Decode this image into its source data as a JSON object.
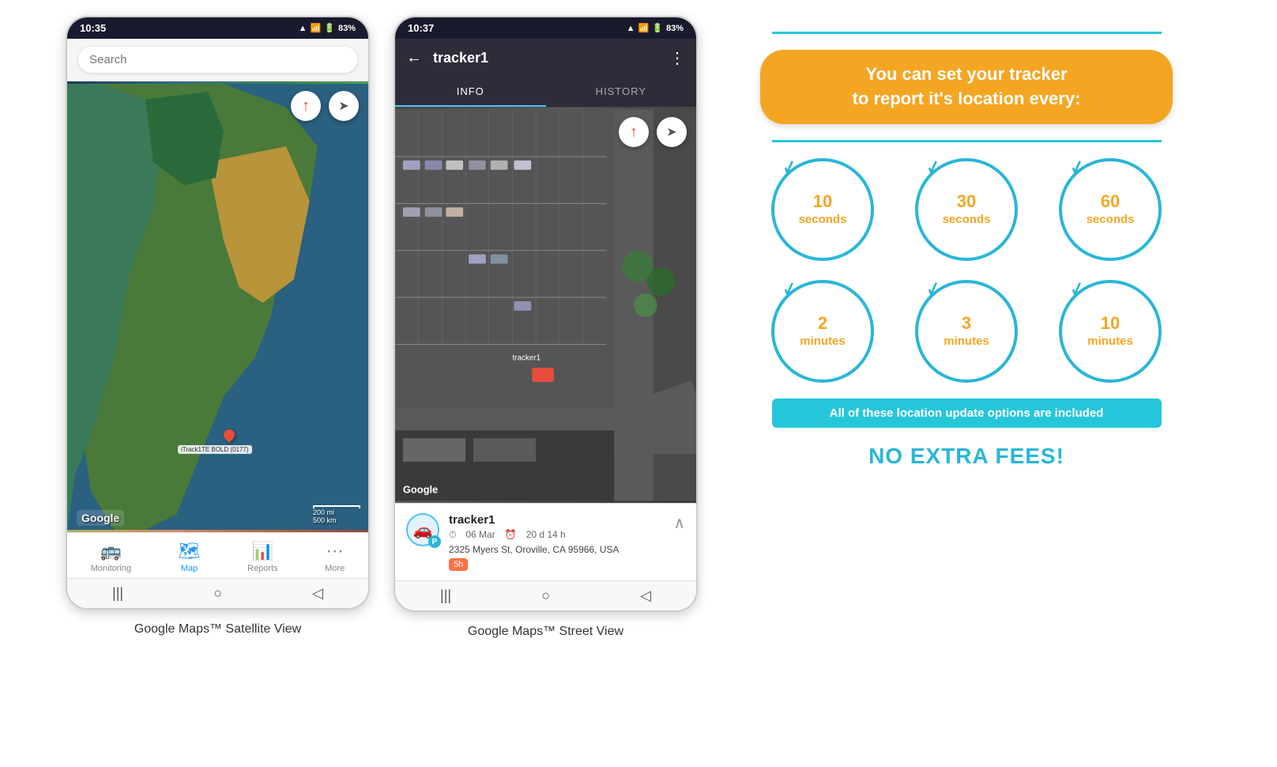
{
  "phone1": {
    "status_time": "10:35",
    "status_signal": "▲ .ill",
    "status_battery": "83%",
    "search_placeholder": "Search",
    "google_logo": "Google",
    "scale_text": "200 mi\n500 km",
    "tracker_label": "iTrack1TE BOLD (0177)",
    "nav_items": [
      {
        "label": "Monitoring",
        "icon": "🚌",
        "active": false
      },
      {
        "label": "Map",
        "icon": "📍",
        "active": true
      },
      {
        "label": "Reports",
        "icon": "▦",
        "active": false
      },
      {
        "label": "More",
        "icon": "···",
        "active": false
      }
    ],
    "caption": "Google Maps™ Satellite View"
  },
  "phone2": {
    "status_time": "10:37",
    "status_signal": "▲ .ill",
    "status_battery": "83%",
    "tracker_name": "tracker1",
    "tabs": [
      {
        "label": "INFO",
        "active": true
      },
      {
        "label": "HISTORY",
        "active": false
      }
    ],
    "google_logo": "Google",
    "info_card": {
      "tracker_name": "tracker1",
      "date": "06 Mar",
      "duration": "20 d 14 h",
      "address": "2325 Myers St, Oroville, CA 95966, USA",
      "badge": "5h"
    },
    "caption": "Google Maps™ Street View"
  },
  "info_panel": {
    "headline": "You can set your tracker\nto report it's location every:",
    "circles": [
      {
        "value": "10",
        "unit": "seconds"
      },
      {
        "value": "30",
        "unit": "seconds"
      },
      {
        "value": "60",
        "unit": "seconds"
      },
      {
        "value": "2",
        "unit": "minutes"
      },
      {
        "value": "3",
        "unit": "minutes"
      },
      {
        "value": "10",
        "unit": "minutes"
      }
    ],
    "banner_text": "All of these location update options are included",
    "no_fees_text": "NO EXTRA FEES!"
  }
}
